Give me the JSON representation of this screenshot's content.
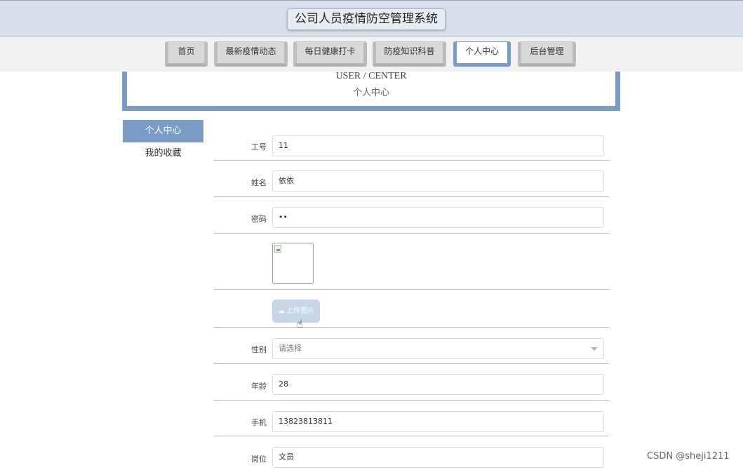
{
  "header": {
    "title": "公司人员疫情防空管理系统"
  },
  "nav": {
    "items": [
      {
        "label": "首页"
      },
      {
        "label": "最新疫情动态"
      },
      {
        "label": "每日健康打卡"
      },
      {
        "label": "防疫知识科普"
      },
      {
        "label": "个人中心"
      },
      {
        "label": "后台管理"
      }
    ],
    "active_index": 4
  },
  "page_header": {
    "en": "USER / CENTER",
    "cn": "个人中心"
  },
  "side_menu": {
    "items": [
      {
        "label": "个人中心"
      },
      {
        "label": "我的收藏"
      }
    ]
  },
  "form": {
    "employee_id": {
      "label": "工号",
      "value": "11"
    },
    "name": {
      "label": "姓名",
      "value": "依依"
    },
    "password": {
      "label": "密码",
      "value": "••"
    },
    "upload": {
      "label": "上传图片",
      "icon": "cloud-upload-icon"
    },
    "gender": {
      "label": "性别",
      "placeholder": "请选择"
    },
    "age": {
      "label": "年龄",
      "value": "28"
    },
    "phone": {
      "label": "手机",
      "value": "13823813811"
    },
    "position": {
      "label": "岗位",
      "value": "文员"
    }
  },
  "watermark": "CSDN @sheji1211",
  "colors": {
    "accent": "#7b9cc6",
    "top_band": "#d7e0ea",
    "upload_button": "#c7d5e4"
  }
}
